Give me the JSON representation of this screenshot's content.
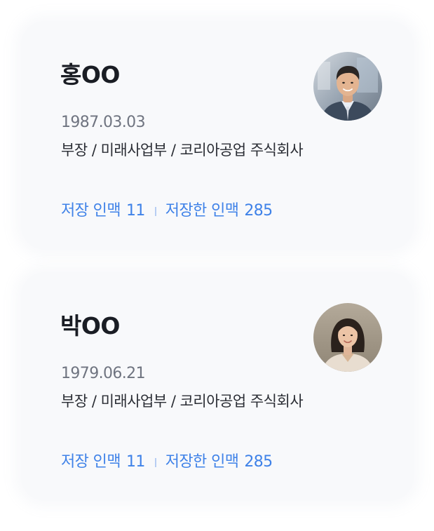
{
  "profiles": [
    {
      "name": "홍OO",
      "birthdate": "1987.03.03",
      "affiliation": "부장 / 미래사업부 / 코리아공업 주식회사",
      "saved_label": "저장 인맥",
      "saved_count": "11",
      "saved_by_label": "저장한 인맥",
      "saved_by_count": "285",
      "avatar_icon": "man-portrait-photo"
    },
    {
      "name": "박OO",
      "birthdate": "1979.06.21",
      "affiliation": "부장 / 미래사업부 / 코리아공업 주식회사",
      "saved_label": "저장 인맥",
      "saved_count": "11",
      "saved_by_label": "저장한 인맥",
      "saved_by_count": "285",
      "avatar_icon": "woman-portrait-photo"
    }
  ],
  "colors": {
    "card_bg": "#f8f9fb",
    "name": "#1a1d24",
    "birthdate": "#6f7480",
    "affiliation": "#2a2d34",
    "accent": "#3f82e8"
  }
}
